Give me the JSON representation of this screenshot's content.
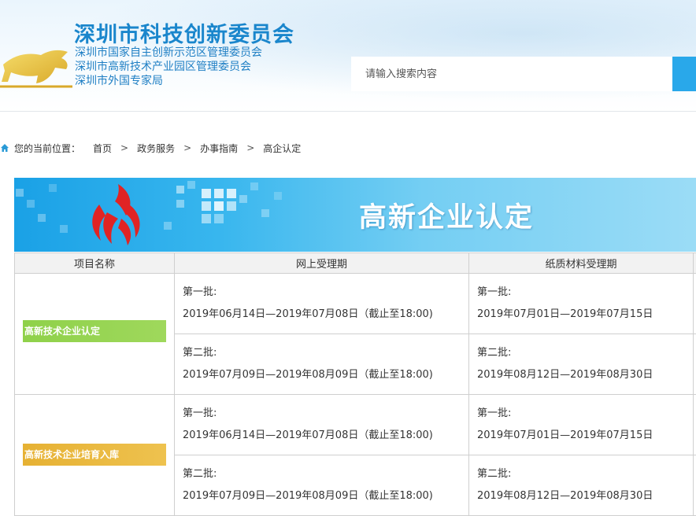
{
  "header": {
    "title": "深圳市科技创新委员会",
    "subtitles": [
      "深圳市国家自主创新示范区管理委员会",
      "深圳市高新技术产业园区管理委员会",
      "深圳市外国专家局"
    ],
    "search_placeholder": "请输入搜索内容",
    "accent_color": "#1a86cc"
  },
  "breadcrumb": {
    "label": "您的当前位置：",
    "items": [
      "首页",
      "政务服务",
      "办事指南",
      "高企认定"
    ],
    "separator": ">"
  },
  "banner": {
    "title": "高新企业认定"
  },
  "table": {
    "headers": [
      "项目名称",
      "网上受理期",
      "纸质材料受理期"
    ],
    "rows": [
      {
        "name": "高新技术企业认定",
        "tag_color": "#8fd14a",
        "batches": [
          {
            "label": "第一批:",
            "online": "2019年06月14日—2019年07月08日（截止至18:00)",
            "paper_label": "第一批:",
            "paper": "2019年07月01日—2019年07月15日"
          },
          {
            "label": "第二批:",
            "online": "2019年07月09日—2019年08月09日（截止至18:00)",
            "paper_label": "第二批:",
            "paper": "2019年08月12日—2019年08月30日"
          }
        ]
      },
      {
        "name": "高新技术企业培育入库",
        "tag_color": "#e9b93b",
        "batches": [
          {
            "label": "第一批:",
            "online": "2019年06月14日—2019年07月08日（截止至18:00)",
            "paper_label": "第一批:",
            "paper": "2019年07月01日—2019年07月15日"
          },
          {
            "label": "第二批:",
            "online": "2019年07月09日—2019年08月09日（截止至18:00)",
            "paper_label": "第二批:",
            "paper": "2019年08月12日—2019年08月30日"
          }
        ]
      }
    ]
  }
}
